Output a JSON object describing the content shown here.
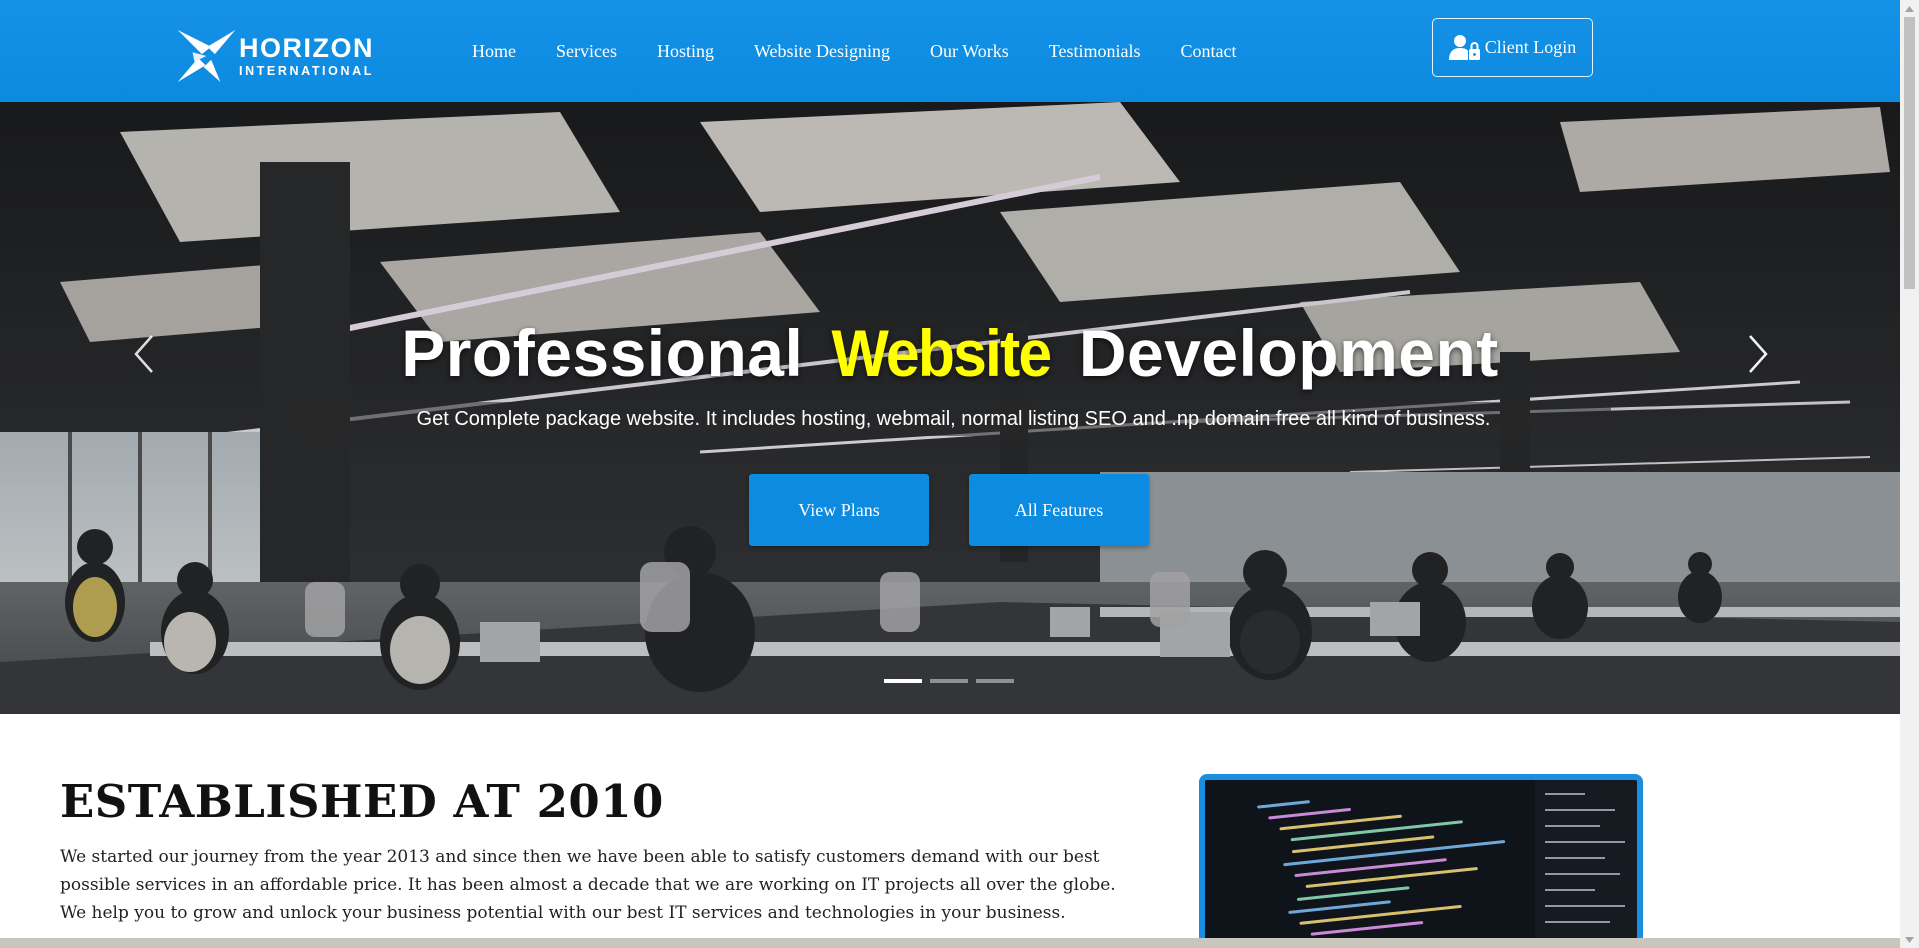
{
  "header": {
    "logo": {
      "name": "HORIZON",
      "sub": "INTERNATIONAL"
    },
    "nav": [
      {
        "label": "Home"
      },
      {
        "label": "Services"
      },
      {
        "label": "Hosting"
      },
      {
        "label": "Website Designing"
      },
      {
        "label": "Our Works"
      },
      {
        "label": "Testimonials"
      },
      {
        "label": "Contact"
      }
    ],
    "client_login": "Client Login"
  },
  "hero": {
    "title_before": "Professional ",
    "title_highlight": "Website",
    "title_after": " Development",
    "subtitle": "Get Complete package website. It includes hosting, webmail, normal listing SEO and .np domain free all kind of business.",
    "buttons": {
      "view_plans": "View Plans",
      "all_features": "All Features"
    },
    "slides": 3,
    "active_slide": 1
  },
  "about": {
    "title": "ESTABLISHED AT 2010",
    "text": "We started our journey from the year 2013 and since then we have been able to satisfy customers demand with our best possible services in an affordable price. It has been almost a decade that we are working on IT projects all over the globe. We help you to grow and unlock your business potential with our best IT services and technologies in your business."
  },
  "colors": {
    "header_blue": "#0b8ae0",
    "button_blue": "#0d8be0",
    "highlight_yellow": "#ffff00"
  }
}
